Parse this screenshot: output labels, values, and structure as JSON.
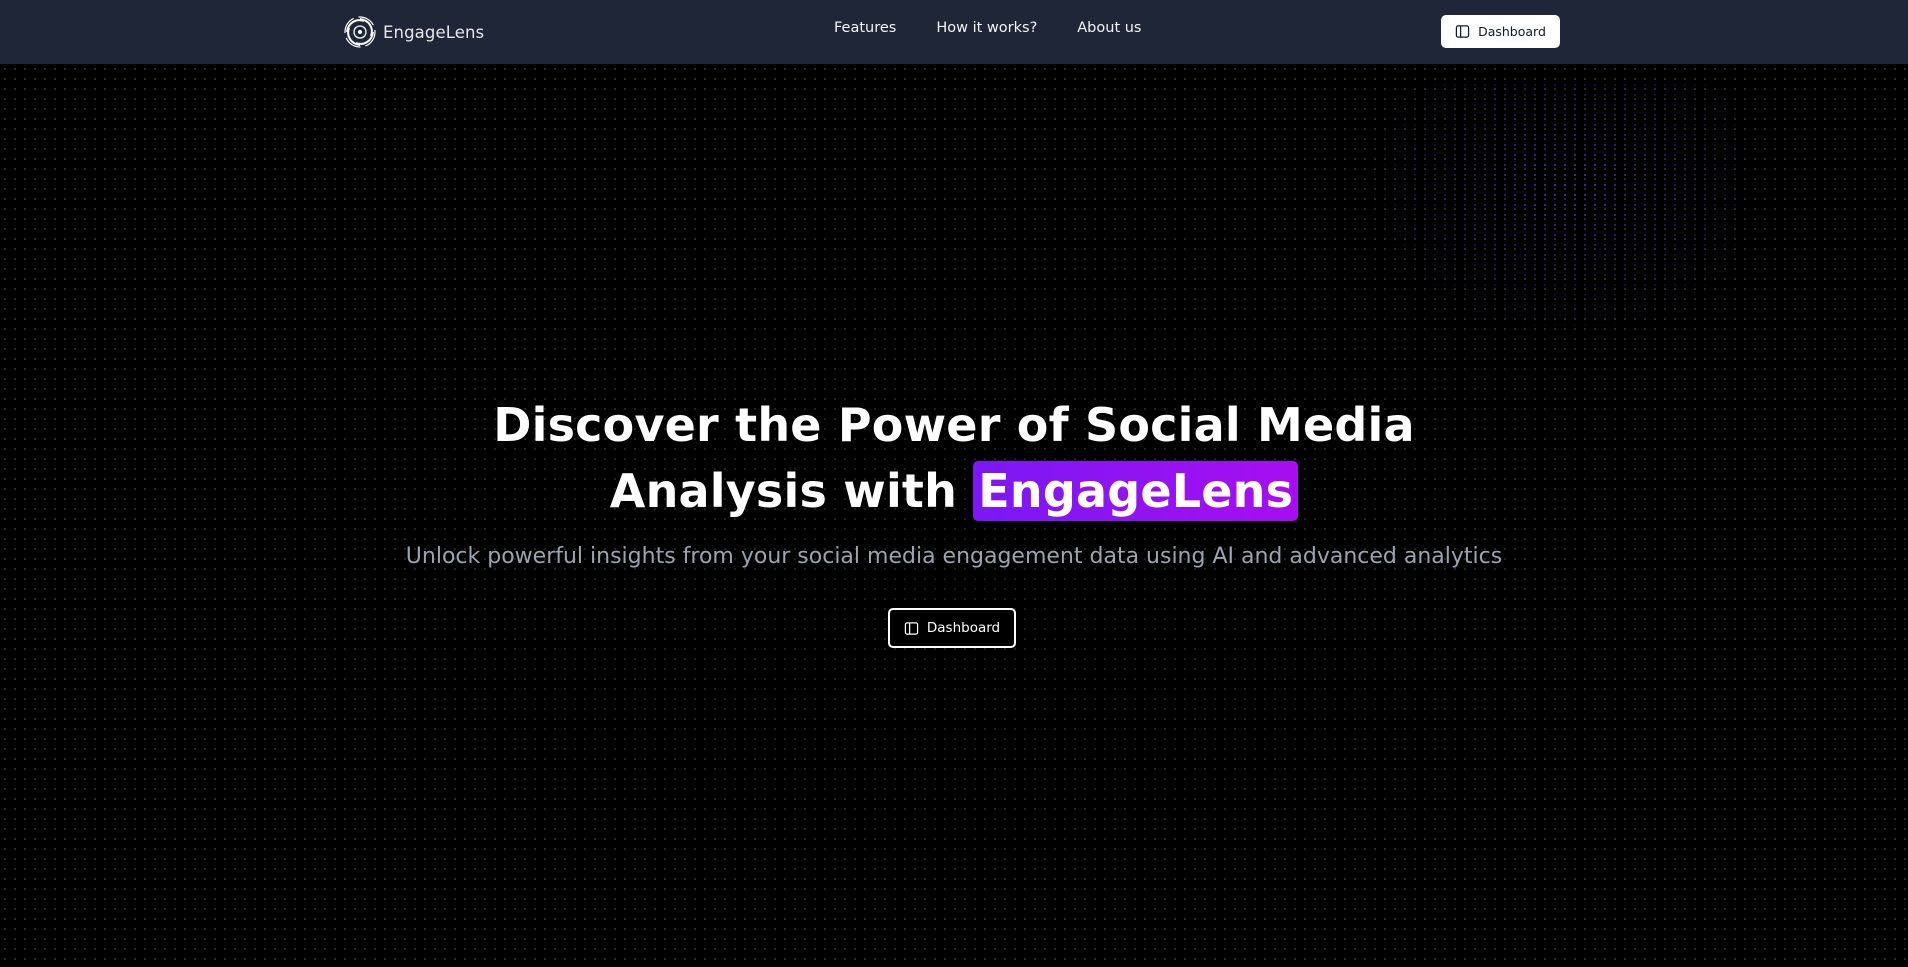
{
  "navbar": {
    "brand_name": "EngageLens",
    "links": [
      {
        "label": "Features"
      },
      {
        "label": "How it works?"
      },
      {
        "label": "About us"
      }
    ],
    "dashboard_label": "Dashboard"
  },
  "hero": {
    "title_line1": "Discover the Power of Social Media",
    "title_line2_prefix": "Analysis with ",
    "title_highlight": "EngageLens",
    "subtitle": "Unlock powerful insights from your social media engagement data using AI and advanced analytics",
    "button_label": "Dashboard"
  },
  "colors": {
    "navbar_bg": "#1e2637",
    "page_bg": "#000000",
    "highlight_start": "#7b18f5",
    "highlight_end": "#a70ef0",
    "subtitle": "#9ca3af"
  },
  "icons": {
    "brand": "swirl-logo-icon",
    "dashboard": "sidebar-layout-icon"
  }
}
